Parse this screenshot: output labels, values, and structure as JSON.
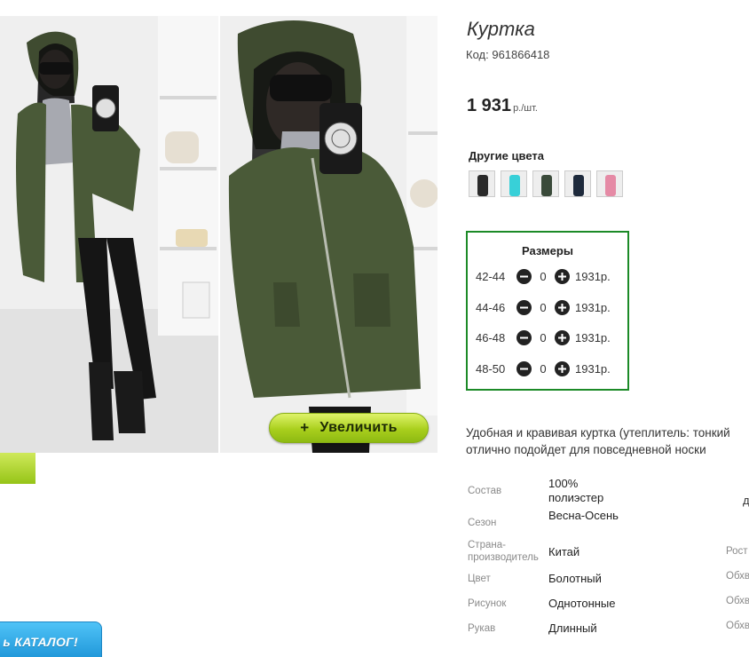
{
  "product": {
    "title": "Куртка",
    "code_label": "Код:",
    "code_value": "961866418",
    "price_value": "1 931",
    "price_unit": "р./шт.",
    "description_line1": "Удобная и кравивая куртка (утеплитель: тонкий",
    "description_line2": "отлично подойдет для повседневной носки"
  },
  "gallery": {
    "zoom_button": "Увеличить",
    "zoom_plus": "+"
  },
  "other_colors": {
    "title": "Другие цвета",
    "swatches": [
      "#2a2a2a",
      "#38d0d8",
      "#3a4a3a",
      "#1e2a3c",
      "#e58aa5"
    ]
  },
  "sizes": {
    "title": "Размеры",
    "rows": [
      {
        "label": "42-44",
        "qty": "0",
        "price": "1931р."
      },
      {
        "label": "44-46",
        "qty": "0",
        "price": "1931р."
      },
      {
        "label": "46-48",
        "qty": "0",
        "price": "1931р."
      },
      {
        "label": "48-50",
        "qty": "0",
        "price": "1931р."
      }
    ]
  },
  "specs": [
    {
      "label": "Состав",
      "value": "100% полиэстер"
    },
    {
      "label": "Сезон",
      "value": "Весна-Осень"
    },
    {
      "label": "Страна-производитель",
      "value": "Китай"
    },
    {
      "label": "Цвет",
      "value": "Болотный"
    },
    {
      "label": "Рисунок",
      "value": "Однотонные"
    },
    {
      "label": "Рукав",
      "value": "Длинный"
    }
  ],
  "right_column": {
    "glyph": "д",
    "labels": [
      "Рост",
      "Обхв",
      "Обхв",
      "Обхв"
    ]
  },
  "catalog_button": "ь КАТАЛОГ!",
  "colors": {
    "accent_green": "#1c8a27",
    "button_lime": "#a9cf1d",
    "catalog_blue": "#1e95d8",
    "jacket_khaki": "#4a5a38"
  }
}
